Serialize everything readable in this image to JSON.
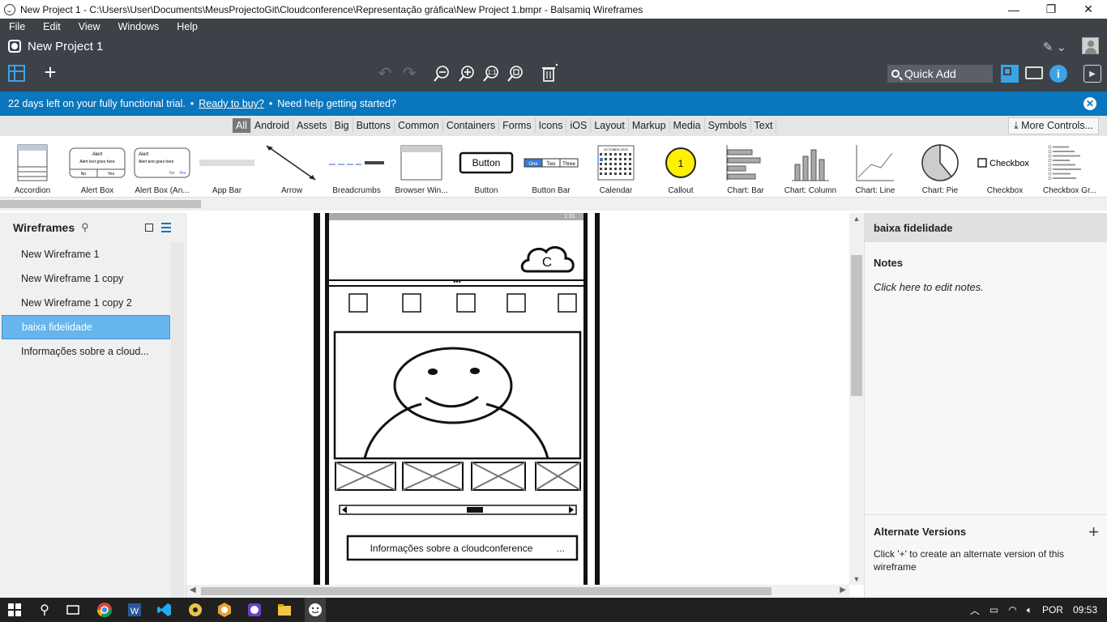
{
  "window": {
    "title": "New Project 1 - C:\\Users\\User\\Documents\\MeusProjectoGit\\Cloudconference\\Representação gráfica\\New Project 1.bmpr - Balsamiq Wireframes",
    "minimize": "—",
    "restore": "❐",
    "close": "✕"
  },
  "menu": [
    "File",
    "Edit",
    "View",
    "Windows",
    "Help"
  ],
  "project": {
    "title": "New Project 1"
  },
  "toolbar": {
    "quick_add": "Quick Add"
  },
  "trial": {
    "days_left": "22 days left on your fully functional trial.",
    "ready": "Ready to buy?",
    "help": "Need help getting started?",
    "bullet": "•"
  },
  "categories": [
    "All",
    "Android",
    "Assets",
    "Big",
    "Buttons",
    "Common",
    "Containers",
    "Forms",
    "Icons",
    "iOS",
    "Layout",
    "Markup",
    "Media",
    "Symbols",
    "Text"
  ],
  "more_controls": "More Controls...",
  "library": [
    {
      "label": "Accordion",
      "icon": "accordion-thumb"
    },
    {
      "label": "Alert Box",
      "icon": "alert-box-thumb"
    },
    {
      "label": "Alert Box (An...",
      "icon": "alert-box-android-thumb"
    },
    {
      "label": "App Bar",
      "icon": "app-bar-thumb"
    },
    {
      "label": "Arrow",
      "icon": "arrow-thumb"
    },
    {
      "label": "Breadcrumbs",
      "icon": "breadcrumbs-thumb"
    },
    {
      "label": "Browser Win...",
      "icon": "browser-window-thumb"
    },
    {
      "label": "Button",
      "icon": "button-thumb"
    },
    {
      "label": "Button Bar",
      "icon": "button-bar-thumb"
    },
    {
      "label": "Calendar",
      "icon": "calendar-thumb"
    },
    {
      "label": "Callout",
      "icon": "callout-thumb"
    },
    {
      "label": "Chart: Bar",
      "icon": "chart-bar-thumb"
    },
    {
      "label": "Chart: Column",
      "icon": "chart-column-thumb"
    },
    {
      "label": "Chart: Line",
      "icon": "chart-line-thumb"
    },
    {
      "label": "Chart: Pie",
      "icon": "chart-pie-thumb"
    },
    {
      "label": "Checkbox",
      "icon": "checkbox-thumb"
    },
    {
      "label": "Checkbox Gr...",
      "icon": "checkbox-group-thumb"
    }
  ],
  "library_thumb_text": {
    "button": "Button",
    "button_bar": [
      "One",
      "Two",
      "Three"
    ],
    "callout": "1",
    "checkbox": "Checkbox",
    "alert": "Alert",
    "alert_body": "Alert text goes here",
    "alert_buttons": [
      "No",
      "Yes"
    ],
    "calendar_header": "OCTOBER 2023"
  },
  "sidebar": {
    "title": "Wireframes",
    "items": [
      {
        "label": "New Wireframe 1"
      },
      {
        "label": "New Wireframe 1 copy"
      },
      {
        "label": "New Wireframe 1 copy 2"
      },
      {
        "label": "baixa fidelidade",
        "selected": true
      },
      {
        "label": "Informações sobre a cloud..."
      }
    ]
  },
  "mockup": {
    "status": "1:31",
    "logo_letter": "C",
    "dots": "•••",
    "footer_button": "Informações sobre a cloudconference",
    "footer_ellipsis": "..."
  },
  "right_panel": {
    "title": "baixa fidelidade",
    "notes_title": "Notes",
    "notes_hint": "Click here to edit notes.",
    "alt_title": "Alternate Versions",
    "alt_desc": "Click '+' to create an alternate version of this wireframe",
    "alt_plus": "+"
  },
  "tray": {
    "lang": "POR",
    "time": "09:53"
  },
  "colors": {
    "accent": "#0a76bd",
    "dark": "#3d4148",
    "selection": "#66b5ec"
  }
}
